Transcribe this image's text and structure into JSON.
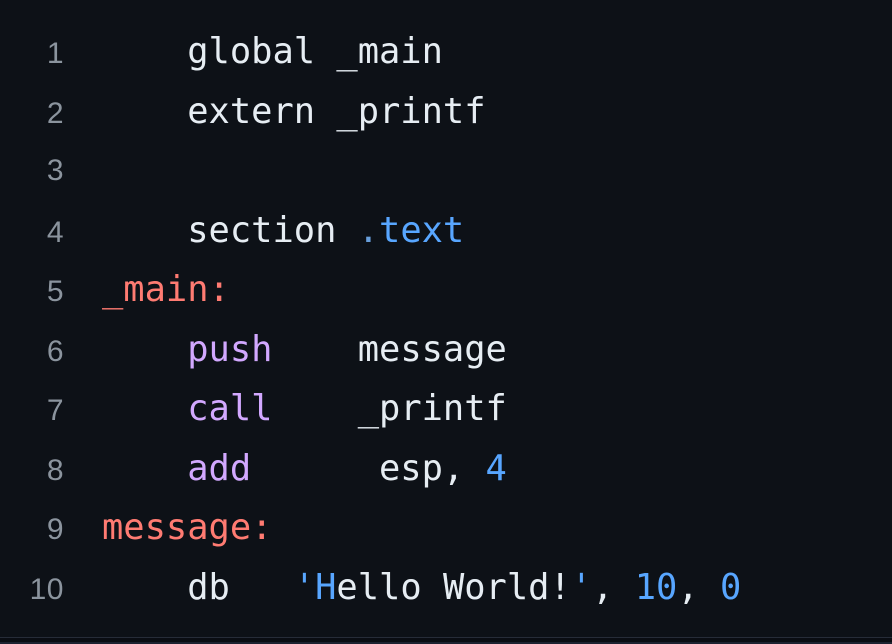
{
  "editor": {
    "language": "nasm-assembly",
    "background_color": "#0d1117",
    "gutter_color": "#8b949e",
    "total_lines": 10,
    "colors": {
      "plain": "#e6edf3",
      "keyword": "#d2a8ff",
      "label": "#ff7b72",
      "section": "#58a6ff",
      "number": "#58a6ff",
      "quote": "#58a6ff"
    }
  },
  "lines": [
    {
      "number": "1",
      "indent": "    ",
      "tokens": [
        {
          "text": "global",
          "type": "plain"
        },
        {
          "text": " ",
          "type": "plain"
        },
        {
          "text": "_main",
          "type": "plain"
        }
      ]
    },
    {
      "number": "2",
      "indent": "    ",
      "tokens": [
        {
          "text": "extern",
          "type": "plain"
        },
        {
          "text": " ",
          "type": "plain"
        },
        {
          "text": "_printf",
          "type": "plain"
        }
      ]
    },
    {
      "number": "3",
      "indent": "",
      "tokens": []
    },
    {
      "number": "4",
      "indent": "    ",
      "tokens": [
        {
          "text": "section",
          "type": "plain"
        },
        {
          "text": " ",
          "type": "plain"
        },
        {
          "text": ".",
          "type": "dot"
        },
        {
          "text": "text",
          "type": "section"
        }
      ]
    },
    {
      "number": "5",
      "indent": "",
      "tokens": [
        {
          "text": "_main:",
          "type": "label"
        }
      ]
    },
    {
      "number": "6",
      "indent": "    ",
      "tokens": [
        {
          "text": "push",
          "type": "keyword"
        },
        {
          "text": "    ",
          "type": "plain"
        },
        {
          "text": "message",
          "type": "plain"
        }
      ]
    },
    {
      "number": "7",
      "indent": "    ",
      "tokens": [
        {
          "text": "call",
          "type": "keyword"
        },
        {
          "text": "    ",
          "type": "plain"
        },
        {
          "text": "_printf",
          "type": "plain"
        }
      ]
    },
    {
      "number": "8",
      "indent": "    ",
      "tokens": [
        {
          "text": "add",
          "type": "keyword"
        },
        {
          "text": "      ",
          "type": "plain"
        },
        {
          "text": "esp",
          "type": "plain"
        },
        {
          "text": ", ",
          "type": "punct"
        },
        {
          "text": "4",
          "type": "number"
        }
      ]
    },
    {
      "number": "9",
      "indent": "",
      "tokens": [
        {
          "text": "message:",
          "type": "label"
        }
      ]
    },
    {
      "number": "10",
      "indent": "    ",
      "tokens": [
        {
          "text": "db",
          "type": "plain"
        },
        {
          "text": "   ",
          "type": "plain"
        },
        {
          "text": "'H",
          "type": "quote"
        },
        {
          "text": "ello World!",
          "type": "string"
        },
        {
          "text": "'",
          "type": "quote"
        },
        {
          "text": ", ",
          "type": "punct"
        },
        {
          "text": "10",
          "type": "number"
        },
        {
          "text": ", ",
          "type": "punct"
        },
        {
          "text": "0",
          "type": "number"
        }
      ]
    }
  ]
}
